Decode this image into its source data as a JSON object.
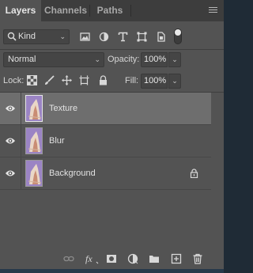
{
  "tabs": [
    {
      "label": "Layers",
      "active": true
    },
    {
      "label": "Channels",
      "active": false
    },
    {
      "label": "Paths",
      "active": false
    }
  ],
  "filter": {
    "kind_label": "Kind",
    "icons": [
      "search-icon",
      "image-filter-icon",
      "adjustment-filter-icon",
      "type-filter-icon",
      "shape-filter-icon",
      "smart-object-filter-icon",
      "filter-toggle"
    ]
  },
  "blend": {
    "mode": "Normal",
    "opacity_label": "Opacity:",
    "opacity_value": "100%"
  },
  "lock": {
    "label": "Lock:",
    "icons": [
      "lock-transparent-pixels-icon",
      "lock-image-pixels-icon",
      "lock-position-icon",
      "lock-artboard-icon",
      "lock-all-icon"
    ],
    "fill_label": "Fill:",
    "fill_value": "100%"
  },
  "layers": [
    {
      "name": "Texture",
      "visible": true,
      "selected": true,
      "locked": false
    },
    {
      "name": "Blur",
      "visible": true,
      "selected": false,
      "locked": false
    },
    {
      "name": "Background",
      "visible": true,
      "selected": false,
      "locked": true
    }
  ],
  "footer_icons": [
    "link-layers-icon",
    "fx-icon",
    "add-mask-icon",
    "adjustment-layer-icon",
    "new-group-icon",
    "new-layer-icon",
    "delete-layer-icon"
  ],
  "colors": {
    "panel_bg": "#535353",
    "tabbar_bg": "#3d3d3d",
    "selected_row": "#6e6e6e",
    "thumb_purple": "#8d73b3"
  }
}
